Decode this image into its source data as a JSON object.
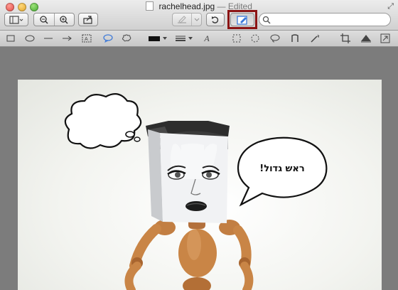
{
  "window": {
    "filename": "rachelhead.jpg",
    "separator": "—",
    "status": "Edited"
  },
  "toolbar": {
    "view_icon": "sidebar-view-icon",
    "zoom_out_icon": "zoom-out-icon",
    "zoom_in_icon": "zoom-in-icon",
    "share_icon": "share-icon",
    "annotate_icon": "pen-icon",
    "rotate_icon": "rotate-icon",
    "edit_toolbar_icon": "edit-toolbar-icon",
    "search_placeholder": ""
  },
  "edit_tools": [
    "rectangle",
    "oval",
    "line",
    "arrow",
    "text-box",
    "speech-bubble",
    "thought-bubble",
    "border-color",
    "line-style",
    "text",
    "rect-select",
    "ellipse-select",
    "lasso-select",
    "smart-lasso",
    "instant-alpha",
    "crop",
    "adjust-color",
    "adjust-size"
  ],
  "image": {
    "speech_text": "ראש גדול!"
  },
  "colors": {
    "highlight": "#8b1414",
    "selected_tool": "#3b78d8",
    "background": "#7c7c7c"
  }
}
